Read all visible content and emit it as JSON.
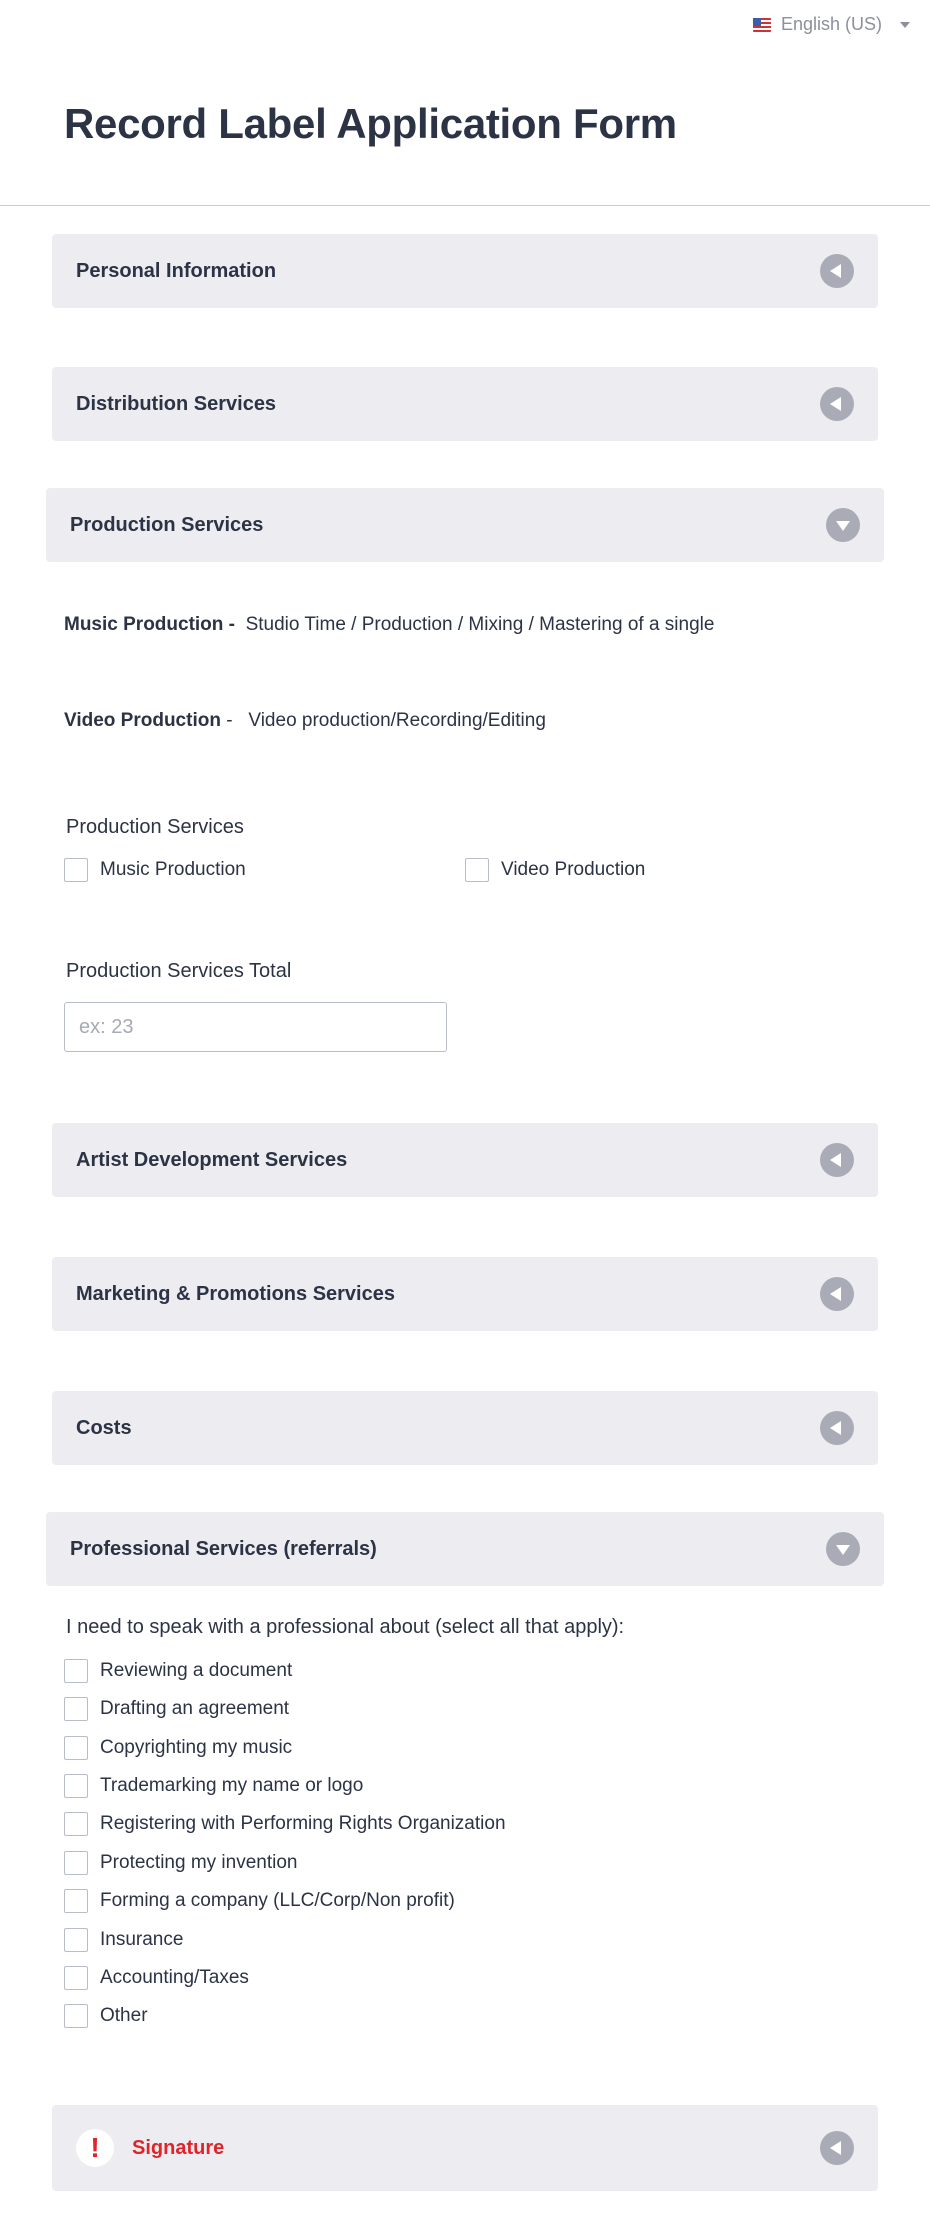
{
  "language": {
    "label": "English (US)"
  },
  "form": {
    "title": "Record Label Application Form"
  },
  "sections": {
    "personal": "Personal Information",
    "distribution": "Distribution Services",
    "production": "Production Services",
    "artist": "Artist Development Services",
    "marketing": "Marketing & Promotions Services",
    "costs": "Costs",
    "professional": "Professional Services (referrals)",
    "signature": "Signature"
  },
  "production": {
    "music_desc_bold": "Music Production -",
    "music_desc": "Studio Time / Production / Mixing / Mastering of a single",
    "video_desc_bold": "Video Production",
    "video_desc": " -   Video production/Recording/Editing",
    "services_label": "Production Services",
    "options": [
      "Music Production",
      "Video Production"
    ],
    "total_label": "Production Services Total",
    "total_placeholder": "ex: 23",
    "total_value": ""
  },
  "professional": {
    "question": "I need to speak with a professional about (select all that apply):",
    "options": [
      "Reviewing a document",
      "Drafting an agreement",
      "Copyrighting my music",
      "Trademarking my name or logo",
      "Registering with Performing Rights Organization",
      "Protecting my invention",
      "Forming a company (LLC/Corp/Non profit)",
      "Insurance",
      "Accounting/Taxes",
      "Other"
    ]
  },
  "icons": {
    "collapsed": "chevron-left-icon",
    "expanded": "chevron-down-icon",
    "alert": "exclamation-icon"
  },
  "colors": {
    "error": "#e0242a",
    "section_bg": "#ededf1",
    "text": "#2c3345"
  }
}
